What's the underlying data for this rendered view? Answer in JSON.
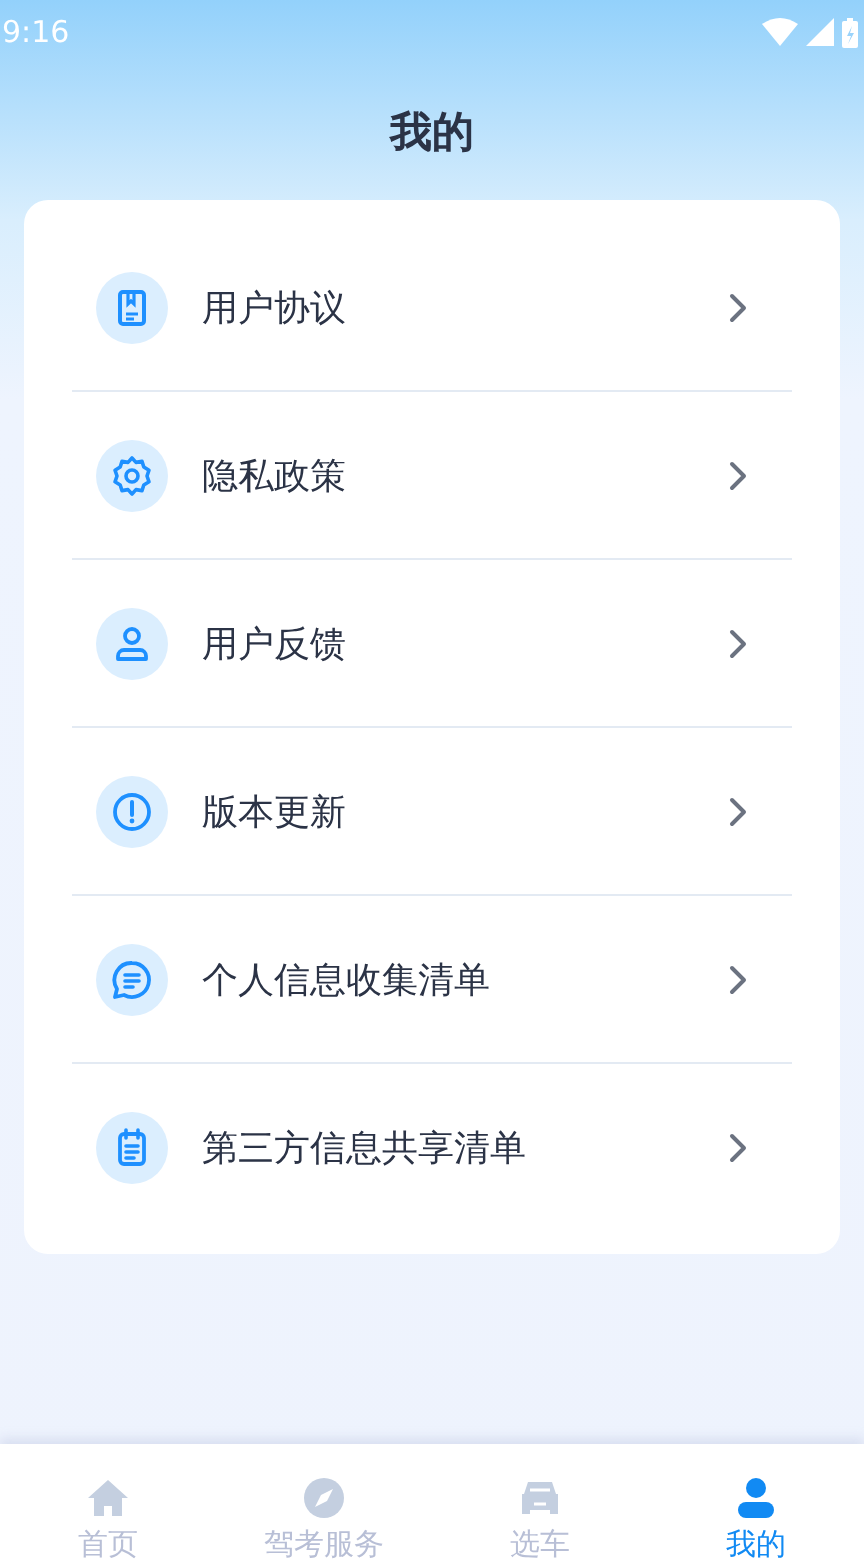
{
  "status_bar": {
    "time": "9:16"
  },
  "header": {
    "title": "我的"
  },
  "menu": [
    {
      "label": "用户协议",
      "kind": "book"
    },
    {
      "label": "隐私政策",
      "kind": "gear"
    },
    {
      "label": "用户反馈",
      "kind": "person"
    },
    {
      "label": "版本更新",
      "kind": "alert"
    },
    {
      "label": "个人信息收集清单",
      "kind": "chat"
    },
    {
      "label": "第三方信息共享清单",
      "kind": "clipboard"
    }
  ],
  "tabs": [
    {
      "label": "首页",
      "kind": "home",
      "selected": false
    },
    {
      "label": "驾考服务",
      "kind": "compass",
      "selected": false
    },
    {
      "label": "选车",
      "kind": "car",
      "selected": false
    },
    {
      "label": "我的",
      "kind": "person",
      "selected": true
    }
  ]
}
